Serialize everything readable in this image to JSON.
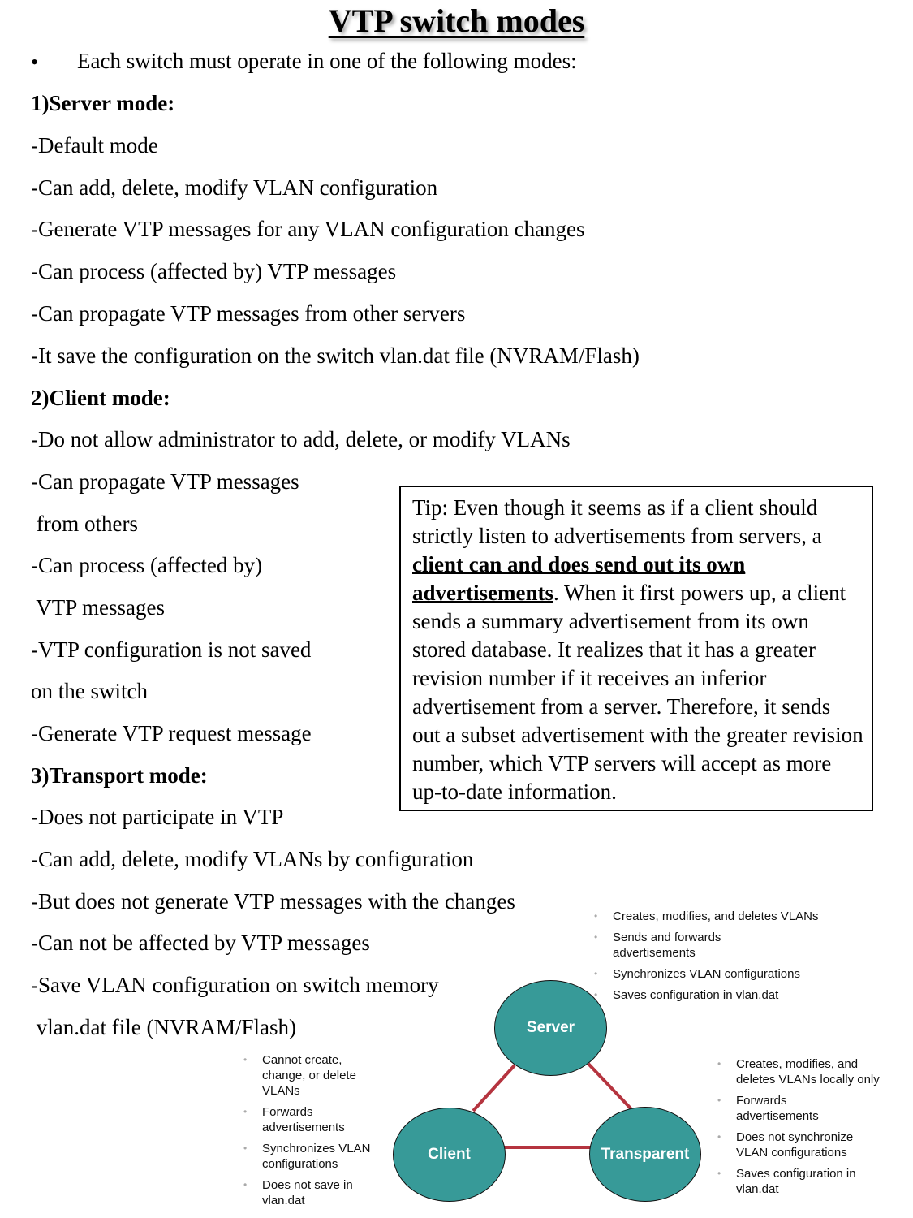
{
  "title": "VTP switch modes",
  "intro": {
    "bullet": "•",
    "text": "Each switch must operate in one of the following modes:"
  },
  "server": {
    "heading": "1)Server mode:",
    "lines": [
      "-Default mode",
      "-Can add, delete, modify VLAN configuration",
      "-Generate VTP messages for any VLAN configuration changes",
      "-Can process (affected by) VTP messages",
      "-Can propagate VTP messages from other servers",
      "-It save the configuration on the switch vlan.dat file (NVRAM/Flash)"
    ]
  },
  "client": {
    "heading": "2)Client mode:",
    "lines": [
      "-Do not allow administrator to add, delete, or modify VLANs",
      "-Can propagate VTP messages",
      " from others",
      "-Can process (affected by)",
      " VTP messages",
      "-VTP configuration is not saved",
      "on the switch",
      "-Generate VTP request message"
    ]
  },
  "transport": {
    "heading": "3)Transport mode:",
    "lines": [
      "-Does not participate in VTP",
      "-Can add, delete, modify VLANs by configuration",
      "-But does not generate VTP messages with the changes",
      "-Can not be affected by VTP messages",
      "-Save VLAN configuration on switch memory",
      " vlan.dat file (NVRAM/Flash)"
    ]
  },
  "tip": {
    "before": "Tip: Even though it seems as if a client should strictly listen to advertisements from servers, a ",
    "emphasis": "client can and does send out its own advertisements",
    "after": ". When it first powers up, a client sends a summary advertisement from its own stored database. It realizes that it has a greater revision number if it receives an inferior advertisement from a server. Therefore, it sends out a subset advertisement with the greater revision number, which VTP servers will accept as more up-to-date information."
  },
  "diagram": {
    "colors": {
      "node_fill": "#379a98",
      "link": "#b5343f"
    },
    "nodes": {
      "server": {
        "label": "Server",
        "bullets": [
          "Creates, modifies, and deletes VLANs",
          "Sends and forwards advertisements",
          "Synchronizes VLAN configurations",
          "Saves configuration in vlan.dat"
        ]
      },
      "client": {
        "label": "Client",
        "bullets": [
          "Cannot create, change, or delete VLANs",
          "Forwards advertisements",
          "Synchronizes VLAN configurations",
          "Does not save in vlan.dat"
        ]
      },
      "transparent": {
        "label": "Transparent",
        "bullets": [
          "Creates, modifies, and deletes VLANs locally only",
          "Forwards advertisements",
          "Does not synchronize VLAN configurations",
          "Saves configuration in vlan.dat"
        ]
      }
    }
  }
}
